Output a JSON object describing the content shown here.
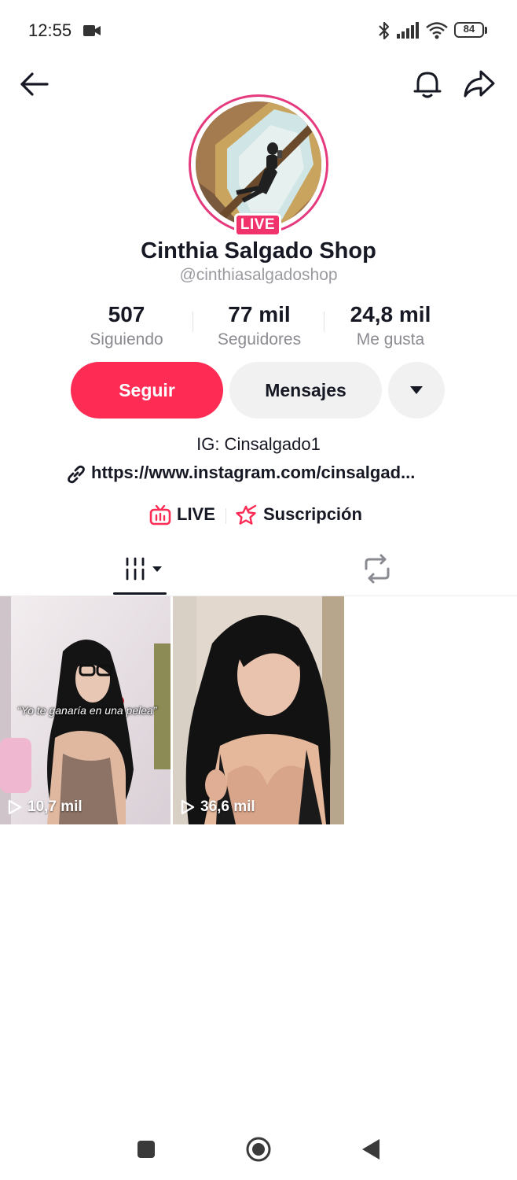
{
  "status_bar": {
    "time": "12:55",
    "battery": "84",
    "icons": [
      "video-camera-icon",
      "bluetooth-icon",
      "signal-icon",
      "wifi-icon",
      "battery-icon"
    ]
  },
  "header": {
    "icons": [
      "back-arrow-icon",
      "bell-icon",
      "share-icon"
    ]
  },
  "profile": {
    "live_badge": "LIVE",
    "display_name": "Cinthia Salgado Shop",
    "handle": "@cinthiasalgadoshop",
    "ring_color": "#e63a7e"
  },
  "stats": [
    {
      "value": "507",
      "label": "Siguiendo"
    },
    {
      "value": "77 mil",
      "label": "Seguidores"
    },
    {
      "value": "24,8 mil",
      "label": "Me gusta"
    }
  ],
  "actions": {
    "follow_label": "Seguir",
    "message_label": "Mensajes",
    "follow_color": "#fe2c55"
  },
  "bio": {
    "text": "IG: Cinsalgado1",
    "link": "https://www.instagram.com/cinsalgad..."
  },
  "quick_links": {
    "live_label": "LIVE",
    "subscription_label": "Suscripción"
  },
  "tabs": {
    "icons": [
      "video-grid-icon",
      "repost-icon"
    ],
    "selected": "video-grid-icon"
  },
  "videos": [
    {
      "views": "10,7 mil",
      "caption": "“Yo te ganaría en una pelea”"
    },
    {
      "views": "36,6 mil"
    }
  ],
  "nav_bar": {
    "icons": [
      "recents-square-icon",
      "home-circle-icon",
      "back-triangle-icon"
    ]
  }
}
